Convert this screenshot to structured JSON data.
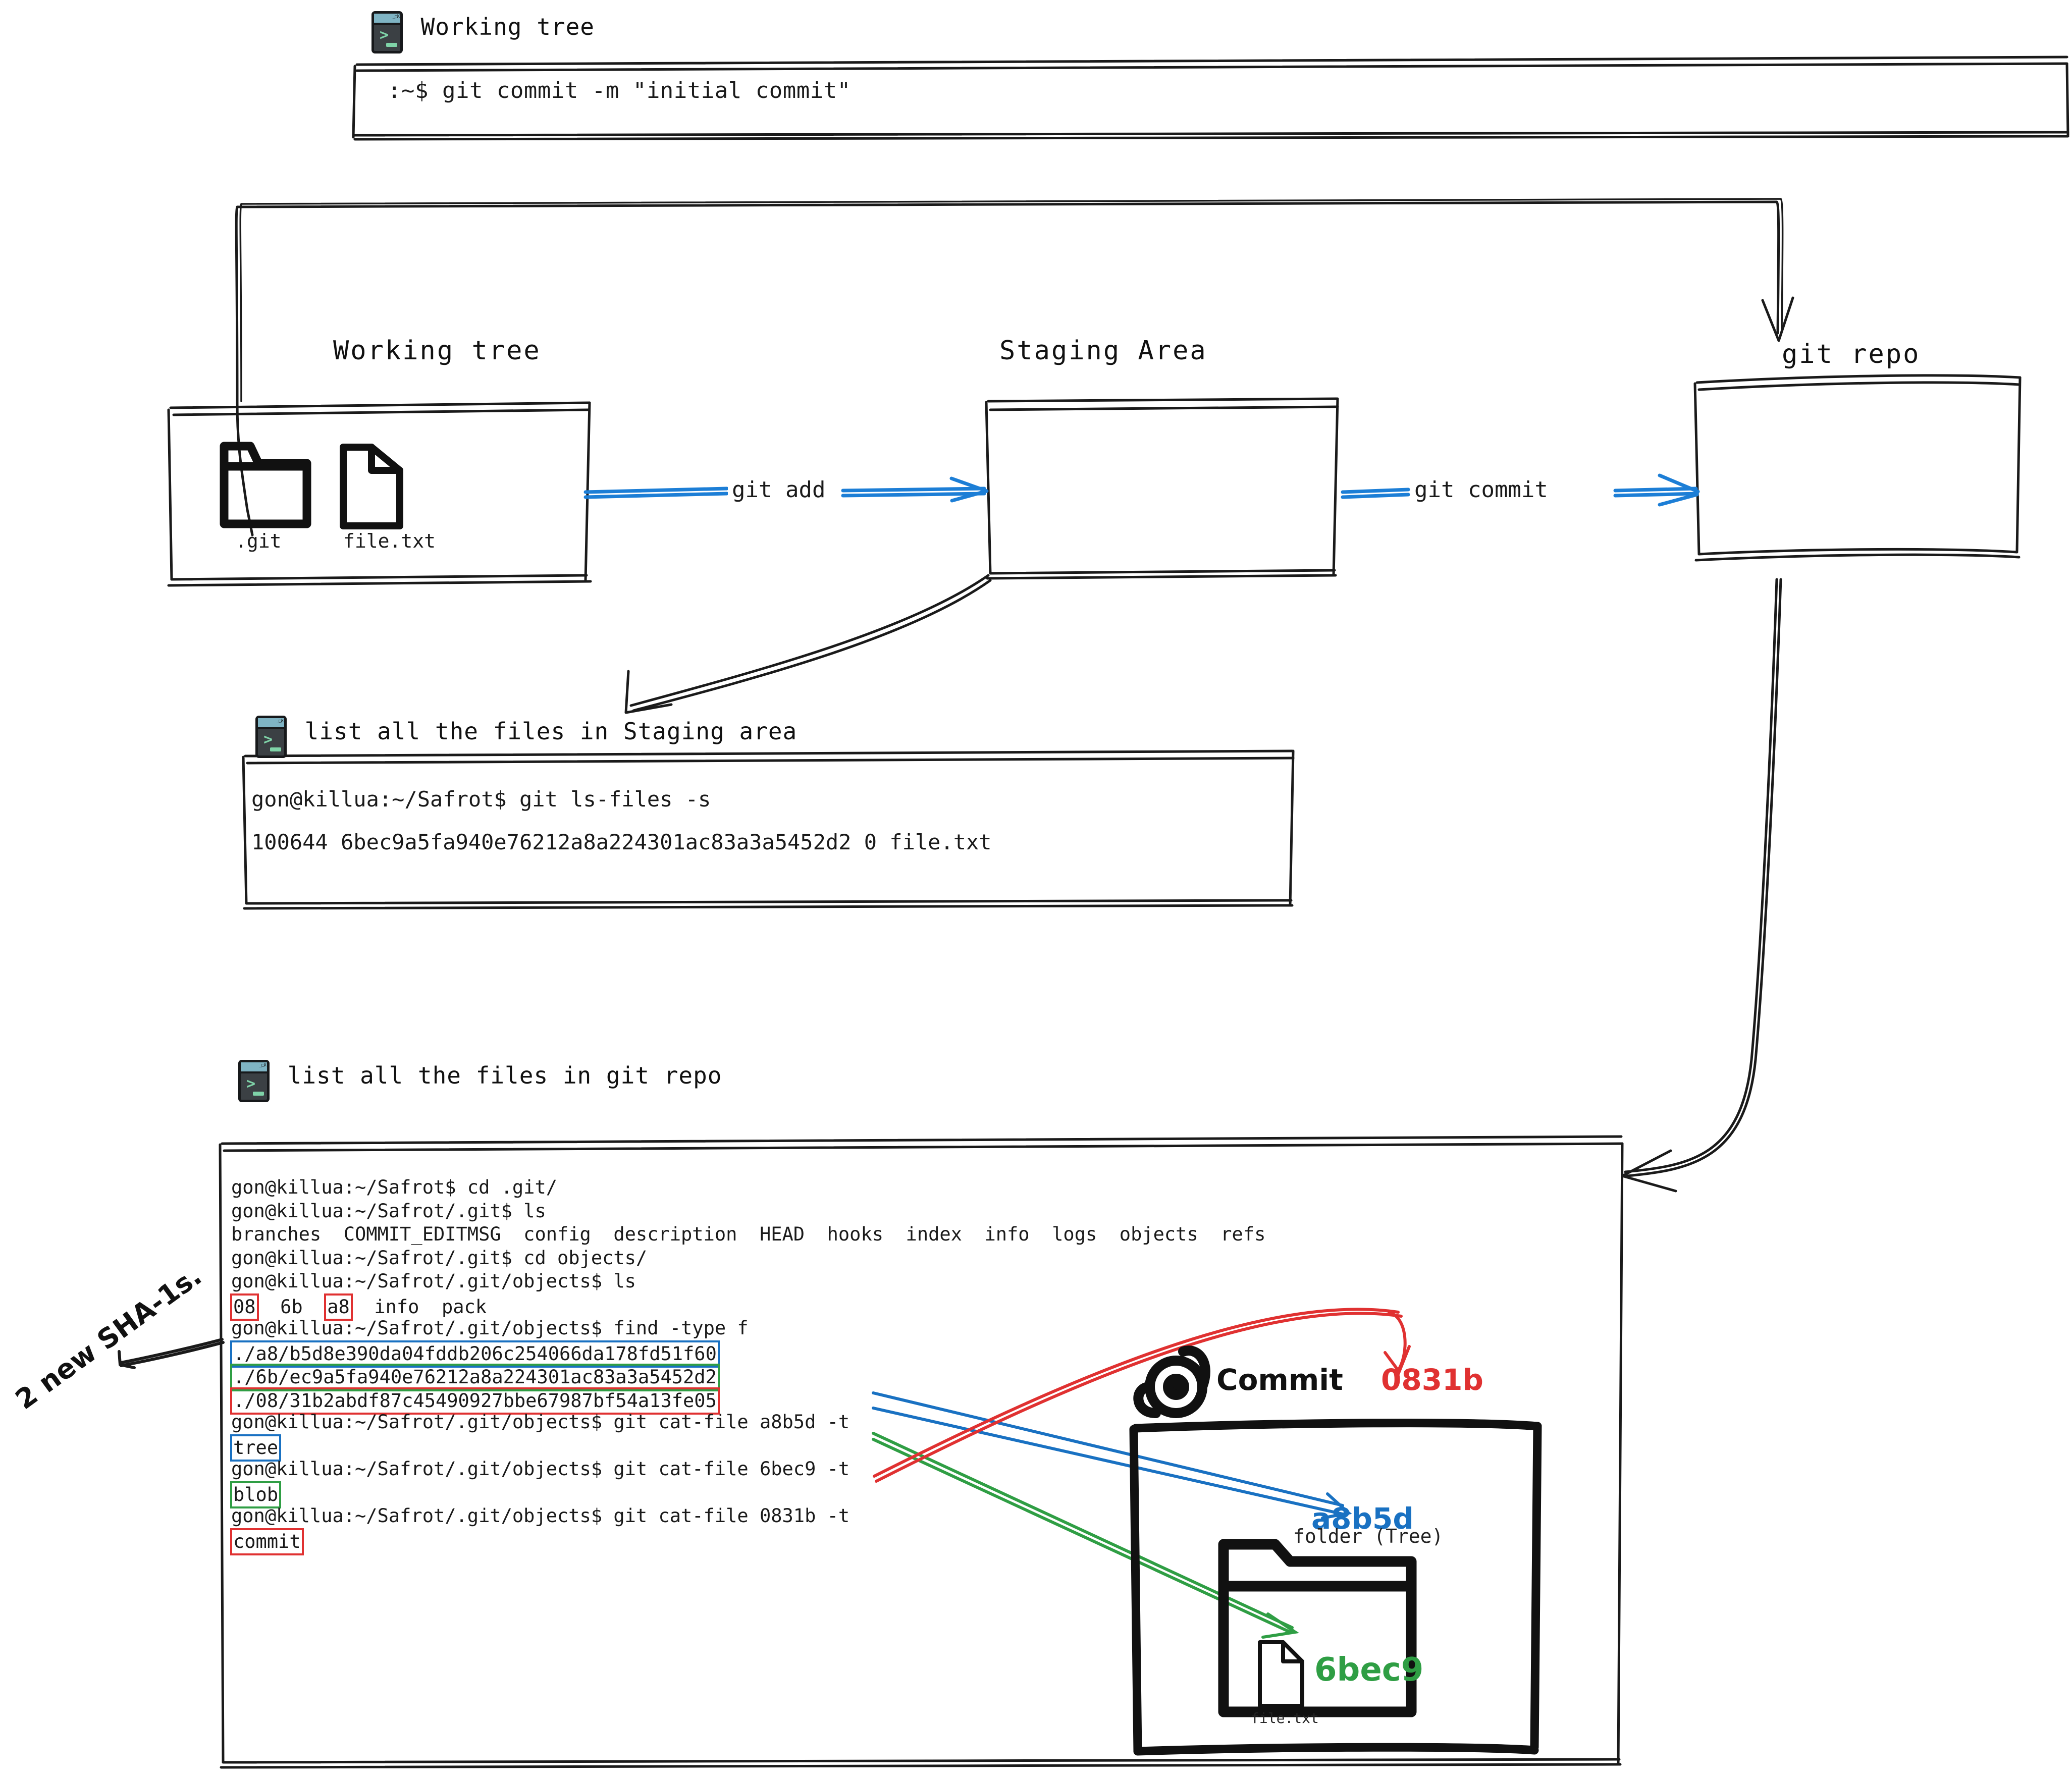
{
  "top_panel": {
    "icon": "terminal-icon",
    "title": "Working tree",
    "command": ":~$ git commit -m \"initial commit\""
  },
  "flow": {
    "working_tree": {
      "label": "Working tree",
      "items": [
        {
          "icon": "folder-icon",
          "caption": ".git"
        },
        {
          "icon": "file-icon",
          "caption": "file.txt"
        }
      ]
    },
    "staging_area": {
      "label": "Staging Area"
    },
    "git_repo": {
      "label": "git repo"
    },
    "arrow_add": "git add",
    "arrow_commit": "git commit"
  },
  "staging_panel": {
    "icon": "terminal-icon",
    "title": "list all the files in Staging area",
    "lines": [
      "gon@killua:~/Safrot$ git ls-files -s",
      "100644 6bec9a5fa940e76212a8a224301ac83a3a5452d2 0 file.txt"
    ]
  },
  "repo_panel": {
    "icon": "terminal-icon",
    "title": "list all the files in git repo",
    "lines": [
      {
        "text": "gon@killua:~/Safrot$ cd .git/"
      },
      {
        "text": "gon@killua:~/Safrot/.git$ ls"
      },
      {
        "text": "branches  COMMIT_EDITMSG  config  description  HEAD  hooks  index  info  logs  objects  refs"
      },
      {
        "text": "gon@killua:~/Safrot/.git$ cd objects/"
      },
      {
        "text": "gon@killua:~/Safrot/.git/objects$ ls"
      },
      {
        "segments": [
          {
            "t": "08",
            "hl": "red"
          },
          {
            "t": "  6b  "
          },
          {
            "t": "a8",
            "hl": "red"
          },
          {
            "t": "  info  pack"
          }
        ]
      },
      {
        "text": "gon@killua:~/Safrot/.git/objects$ find -type f"
      },
      {
        "segments": [
          {
            "t": "./a8/b5d8e390da04fddb206c254066da178fd51f60",
            "hl": "blue"
          }
        ]
      },
      {
        "segments": [
          {
            "t": "./6b/ec9a5fa940e76212a8a224301ac83a3a5452d2",
            "hl": "green"
          }
        ]
      },
      {
        "segments": [
          {
            "t": "./08/31b2abdf87c45490927bbe67987bf54a13fe05",
            "hl": "red"
          }
        ]
      },
      {
        "text": "gon@killua:~/Safrot/.git/objects$ git cat-file a8b5d -t"
      },
      {
        "segments": [
          {
            "t": "tree",
            "hl": "blue"
          }
        ]
      },
      {
        "text": "gon@killua:~/Safrot/.git/objects$ git cat-file 6bec9 -t"
      },
      {
        "segments": [
          {
            "t": "blob",
            "hl": "green"
          }
        ]
      },
      {
        "text": "gon@killua:~/Safrot/.git/objects$ git cat-file 0831b -t"
      },
      {
        "segments": [
          {
            "t": "commit",
            "hl": "red"
          }
        ]
      }
    ]
  },
  "annotation": {
    "note": "2 new SHA-1s."
  },
  "object_diagram": {
    "commit_icon": "commit-node-icon",
    "commit_label": "Commit",
    "commit_sha": "0831b",
    "tree_sha": "a8b5d",
    "tree_caption": "folder (Tree)",
    "blob_sha": "6bec9",
    "blob_caption": "file.txt"
  },
  "colors": {
    "red": "#e03131",
    "blue": "#1971c2",
    "green": "#2f9e44",
    "arrow_blue": "#1c7ed6",
    "ink": "#1a1a1a"
  }
}
